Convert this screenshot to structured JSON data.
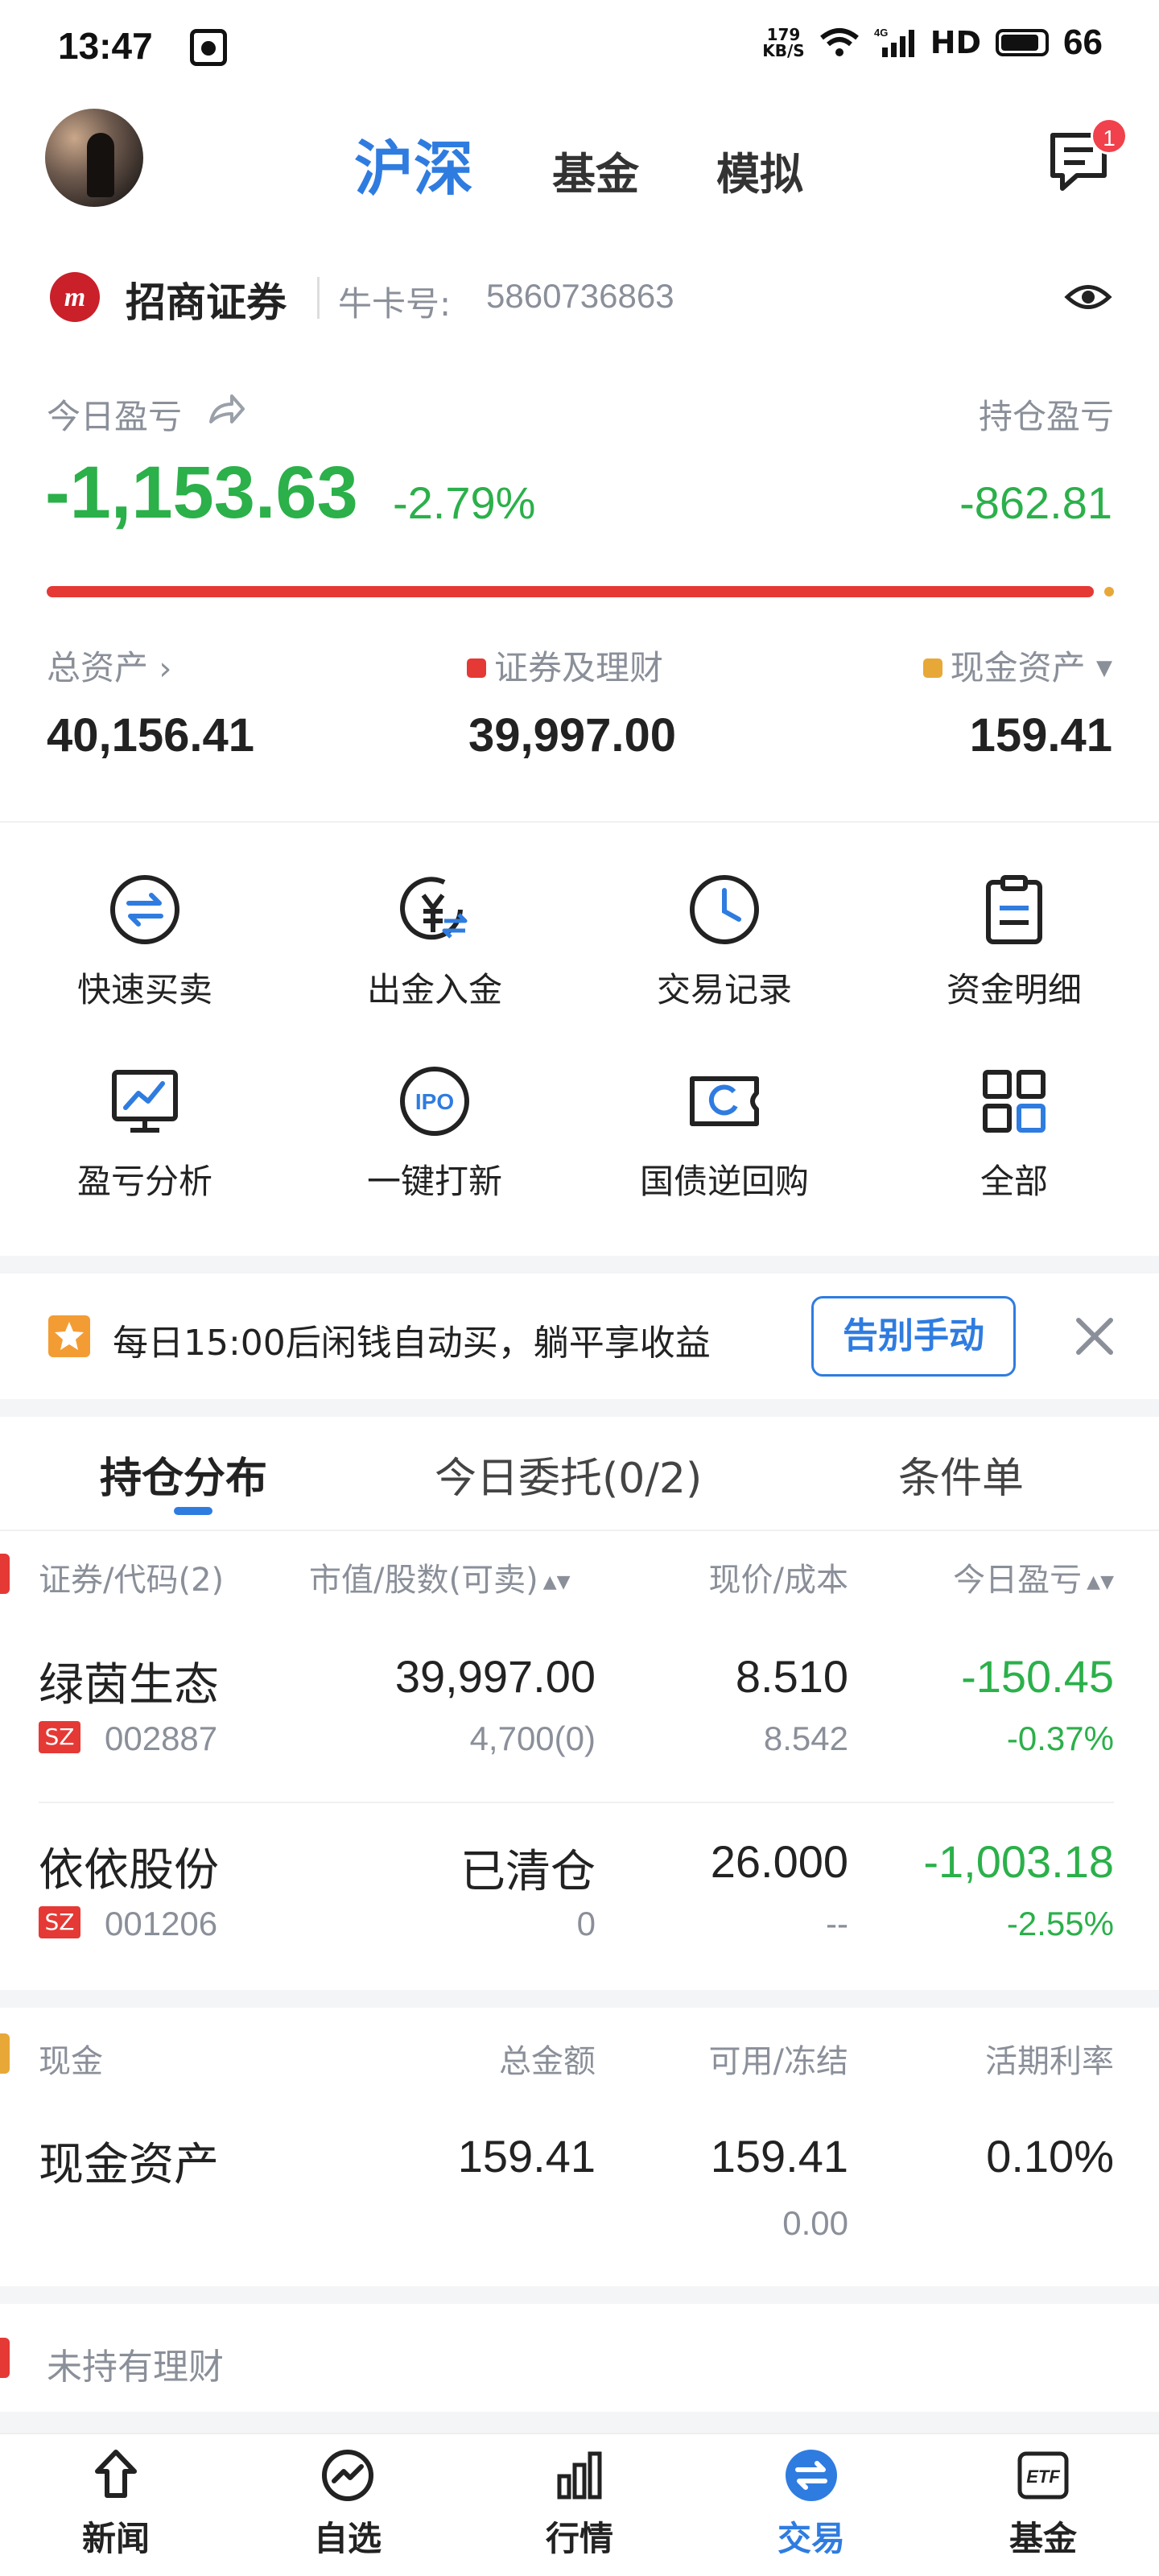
{
  "status_bar": {
    "time": "13:47",
    "net_speed_top": "179",
    "net_speed_bottom": "KB/S",
    "signal_label": "4G",
    "hd": "HD",
    "battery": "66"
  },
  "header": {
    "tabs": [
      "沪深",
      "基金",
      "模拟"
    ],
    "active_tab": "沪深",
    "message_badge": "1"
  },
  "account": {
    "broker": "招商证券",
    "card_label": "牛卡号:",
    "card_no": "5860736863"
  },
  "pnl": {
    "today_label": "今日盈亏",
    "today_value": "-1,153.63",
    "today_pct": "-2.79%",
    "holding_label": "持仓盈亏",
    "holding_value": "-862.81",
    "bar_ratio_securities": 0.996
  },
  "assets": {
    "total_label": "总资产",
    "total_value": "40,156.41",
    "securities_label": "证券及理财",
    "securities_value": "39,997.00",
    "cash_label": "现金资产",
    "cash_value": "159.41",
    "colors": {
      "securities": "#e53935",
      "cash": "#e8a838"
    }
  },
  "quick_actions": [
    {
      "label": "快速买卖",
      "icon": "exchange-icon"
    },
    {
      "label": "出金入金",
      "icon": "yuan-transfer-icon"
    },
    {
      "label": "交易记录",
      "icon": "clock-icon"
    },
    {
      "label": "资金明细",
      "icon": "clipboard-icon"
    },
    {
      "label": "盈亏分析",
      "icon": "chart-monitor-icon"
    },
    {
      "label": "一键打新",
      "icon": "ipo-icon"
    },
    {
      "label": "国债逆回购",
      "icon": "bond-repo-icon"
    },
    {
      "label": "全部",
      "icon": "grid-icon"
    }
  ],
  "banner": {
    "text": "每日15:00后闲钱自动买，躺平享收益",
    "button": "告别手动"
  },
  "holdings_tabs": [
    "持仓分布",
    "今日委托(0/2)",
    "条件单"
  ],
  "holdings": {
    "headers": [
      "证券/代码(2)",
      "市值/股数(可卖)",
      "现价/成本",
      "今日盈亏"
    ],
    "rows": [
      {
        "name": "绿茵生态",
        "market": "SZ",
        "code": "002887",
        "value": "39,997.00",
        "shares": "4,700(0)",
        "price": "8.510",
        "cost": "8.542",
        "pnl": "-150.45",
        "pnl_pct": "-0.37%"
      },
      {
        "name": "依依股份",
        "market": "SZ",
        "code": "001206",
        "value": "已清仓",
        "shares": "0",
        "price": "26.000",
        "cost": "--",
        "pnl": "-1,003.18",
        "pnl_pct": "-2.55%"
      }
    ]
  },
  "cash": {
    "headers": [
      "现金",
      "总金额",
      "可用/冻结",
      "活期利率"
    ],
    "row": {
      "name": "现金资产",
      "total": "159.41",
      "available": "159.41",
      "frozen": "0.00",
      "rate": "0.10%"
    }
  },
  "no_wealth": "未持有理财",
  "bottom_nav": [
    {
      "label": "新闻",
      "icon": "news-icon"
    },
    {
      "label": "自选",
      "icon": "watchlist-icon"
    },
    {
      "label": "行情",
      "icon": "market-icon"
    },
    {
      "label": "交易",
      "icon": "trade-icon"
    },
    {
      "label": "基金",
      "icon": "etf-icon"
    }
  ],
  "bottom_nav_active": "交易",
  "colors": {
    "accent": "#2f7ce0",
    "loss": "#2bb04a",
    "alert": "#f0414c"
  }
}
